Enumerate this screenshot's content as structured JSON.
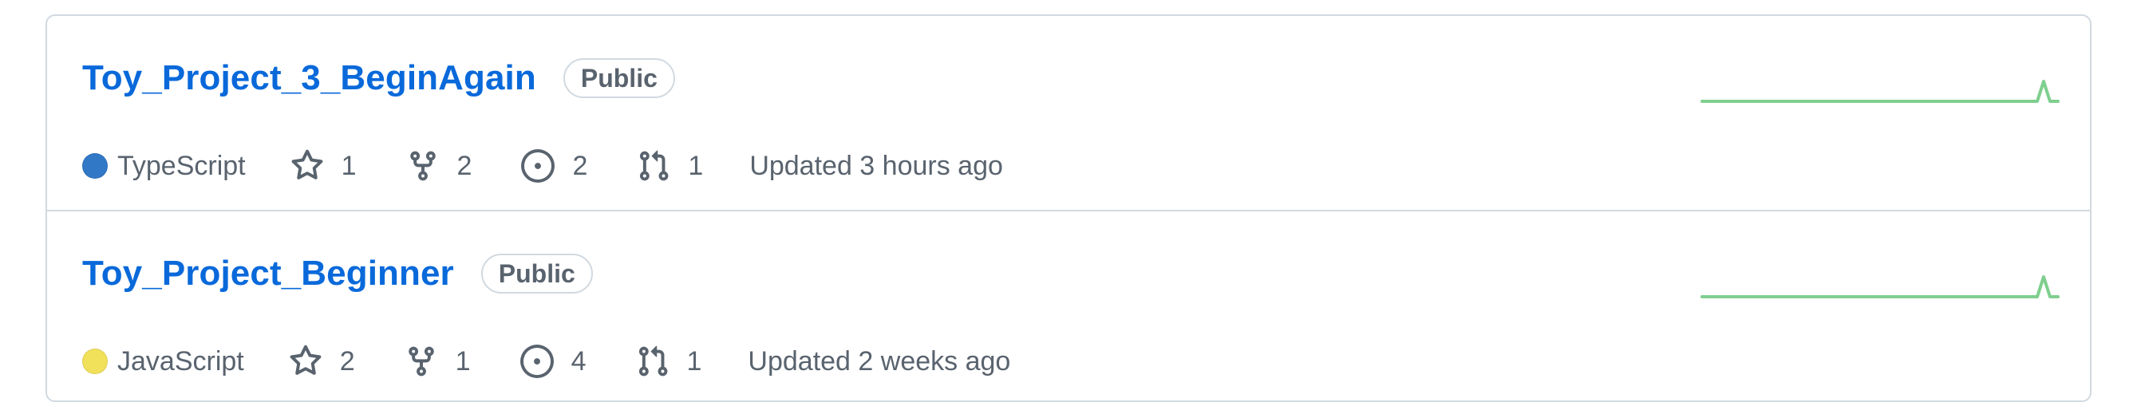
{
  "repositories": [
    {
      "name": "Toy_Project_3_BeginAgain",
      "visibility": "Public",
      "language": "TypeScript",
      "language_color": "#3178c6",
      "stars": "1",
      "forks": "2",
      "issues": "2",
      "pull_requests": "1",
      "updated": "Updated 3 hours ago"
    },
    {
      "name": "Toy_Project_Beginner",
      "visibility": "Public",
      "language": "JavaScript",
      "language_color": "#f1e05a",
      "stars": "2",
      "forks": "1",
      "issues": "4",
      "pull_requests": "1",
      "updated": "Updated 2 weeks ago"
    }
  ],
  "icons": {
    "star": "star-icon",
    "fork": "repo-forked-icon",
    "issue": "issue-opened-icon",
    "pull_request": "git-pull-request-icon"
  },
  "colors": {
    "link": "#0969da",
    "muted": "#59636e",
    "border": "#d1d9e0",
    "sparkline": "#7fcf8e"
  }
}
